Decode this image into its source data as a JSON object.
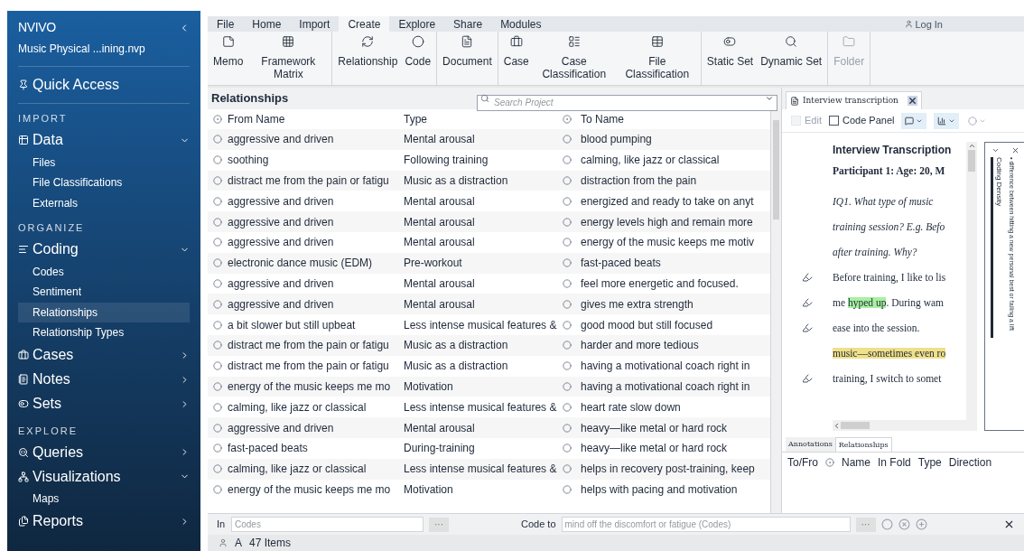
{
  "sidebar": {
    "logo": "NVIVO",
    "project": "Music  Physical ...ining.nvp",
    "nav": [
      {
        "kind": "link",
        "label": "Quick Access"
      },
      {
        "kind": "heading",
        "label": "IMPORT"
      },
      {
        "kind": "group",
        "label": "Data",
        "expanded": true,
        "children": [
          {
            "label": "Files",
            "selected": false
          },
          {
            "label": "File Classifications",
            "selected": false
          },
          {
            "label": "Externals",
            "selected": false
          }
        ]
      },
      {
        "kind": "heading",
        "label": "ORGANIZE"
      },
      {
        "kind": "group",
        "label": "Coding",
        "expanded": true,
        "children": [
          {
            "label": "Codes",
            "selected": false
          },
          {
            "label": "Sentiment",
            "selected": false
          },
          {
            "label": "Relationships",
            "selected": true
          },
          {
            "label": "Relationship Types",
            "selected": false
          }
        ]
      },
      {
        "kind": "group",
        "label": "Cases",
        "expanded": false
      },
      {
        "kind": "group",
        "label": "Notes",
        "expanded": false
      },
      {
        "kind": "group",
        "label": "Sets",
        "expanded": false
      },
      {
        "kind": "heading",
        "label": "EXPLORE"
      },
      {
        "kind": "group",
        "label": "Queries",
        "expanded": false
      },
      {
        "kind": "group",
        "label": "Visualizations",
        "expanded": true,
        "children": [
          {
            "label": "Maps",
            "selected": false
          }
        ]
      },
      {
        "kind": "group",
        "label": "Reports",
        "expanded": false
      }
    ]
  },
  "menu_tabs": [
    {
      "label": "File",
      "selected": false
    },
    {
      "label": "Home",
      "selected": false
    },
    {
      "label": "Import",
      "selected": false
    },
    {
      "label": "Create",
      "selected": true
    },
    {
      "label": "Explore",
      "selected": false
    },
    {
      "label": "Share",
      "selected": false
    },
    {
      "label": "Modules",
      "selected": false
    }
  ],
  "login": "Log In",
  "ribbon": [
    {
      "buttons": [
        {
          "label": "Memo",
          "disabled": false
        },
        {
          "label": "Framework Matrix",
          "disabled": false
        }
      ]
    },
    {
      "buttons": [
        {
          "label": "Relationship",
          "disabled": false
        },
        {
          "label": "Code",
          "disabled": false
        }
      ]
    },
    {
      "buttons": [
        {
          "label": "Document",
          "disabled": false
        }
      ]
    },
    {
      "buttons": [
        {
          "label": "Case",
          "disabled": false
        },
        {
          "label": "Case Classification",
          "disabled": false
        },
        {
          "label": "File Classification",
          "disabled": false
        }
      ]
    },
    {
      "buttons": [
        {
          "label": "Static Set",
          "disabled": false
        },
        {
          "label": "Dynamic Set",
          "disabled": false
        }
      ]
    },
    {
      "buttons": [
        {
          "label": "Folder",
          "disabled": true
        }
      ]
    }
  ],
  "list": {
    "title": "Relationships",
    "search": {
      "placeholder": "Search Project"
    },
    "columns": [
      "From Name",
      "Type",
      "To Name"
    ],
    "rows": [
      [
        "aggressive and driven",
        "Mental arousal",
        "blood pumping"
      ],
      [
        "soothing",
        "Following training",
        "calming, like jazz or classical"
      ],
      [
        "distract me from the pain or fatigu",
        "Music as a distraction",
        "distraction from the pain"
      ],
      [
        "aggressive and driven",
        "Mental arousal",
        "energized and ready to take on anyt"
      ],
      [
        "aggressive and driven",
        "Mental arousal",
        "energy levels high and remain more"
      ],
      [
        "aggressive and driven",
        "Mental arousal",
        "energy of the music keeps me motiv"
      ],
      [
        "electronic dance music (EDM)",
        "Pre-workout",
        "fast-paced beats"
      ],
      [
        "aggressive and driven",
        "Mental arousal",
        "feel more energetic and focused."
      ],
      [
        "aggressive and driven",
        "Mental arousal",
        "gives me extra strength"
      ],
      [
        "a bit slower but still upbeat",
        "Less intense musical features &",
        "good mood but still focused"
      ],
      [
        "distract me from the pain or fatigu",
        "Music as a distraction",
        "harder and more tedious"
      ],
      [
        "distract me from the pain or fatigu",
        "Music as a distraction",
        "having a motivational coach right in"
      ],
      [
        "energy of the music keeps me mo",
        "Motivation",
        "having a motivational coach right in"
      ],
      [
        "calming, like jazz or classical",
        "Less intense musical features &",
        "heart rate slow down"
      ],
      [
        "aggressive and driven",
        "Mental arousal",
        "heavy—like metal or hard rock"
      ],
      [
        "fast-paced beats",
        "During-training",
        "heavy—like metal or hard rock"
      ],
      [
        "calming, like jazz or classical",
        "Less intense musical features &",
        "helps in recovery post-training, keep"
      ],
      [
        "energy of the music keeps me mo",
        "Motivation",
        "helps with pacing and motivation"
      ]
    ]
  },
  "document": {
    "tab": "Interview transcription",
    "edit": {
      "label": "Edit",
      "checked": false,
      "disabled": true
    },
    "code_panel": {
      "label": "Code Panel",
      "checked": false,
      "disabled": false
    },
    "heading": "Interview Transcription",
    "subheading": "Participant 1: Age: 20, M",
    "lines": [
      {
        "kind": "question",
        "marker": false,
        "parts": [
          {
            "text": "IQ1. What type of music"
          }
        ]
      },
      {
        "kind": "question",
        "marker": false,
        "parts": [
          {
            "text": "training session? E.g. Befo"
          }
        ]
      },
      {
        "kind": "question",
        "marker": false,
        "parts": [
          {
            "text": "after training. Why?"
          }
        ]
      },
      {
        "kind": "answer",
        "marker": true,
        "parts": [
          {
            "text": "Before training, I like to lis"
          }
        ]
      },
      {
        "kind": "answer",
        "marker": true,
        "parts": [
          {
            "text": "me "
          },
          {
            "text": "hyped up",
            "color": "#a8f0a0"
          },
          {
            "text": ". During wam"
          }
        ]
      },
      {
        "kind": "answer",
        "marker": true,
        "parts": [
          {
            "text": "ease into the session."
          }
        ]
      },
      {
        "kind": "answer",
        "marker": false,
        "parts": [
          {
            "text": "music—sometimes even ro",
            "color": "#efe08a"
          }
        ]
      },
      {
        "kind": "answer",
        "marker": true,
        "parts": [
          {
            "text": "training, I switch to somet"
          }
        ]
      }
    ],
    "stripes": {
      "title": "Coding Density",
      "items": [
        "• difference between hitting a new personal best or failing a lift"
      ]
    },
    "bottom_tabs": [
      {
        "label": "Annotations",
        "selected": false
      },
      {
        "label": "Relationships",
        "selected": true
      }
    ],
    "bottom_columns": [
      "To/Fro",
      "Name",
      "In Fold",
      "Type",
      "Direction"
    ]
  },
  "footer": {
    "in_label": "In",
    "in_placeholder": "Codes",
    "more": "···",
    "code_to_label": "Code to",
    "code_to_placeholder": "mind off the discomfort or fatigue (Codes)"
  },
  "status": {
    "letter": "A",
    "count": "47 Items"
  }
}
